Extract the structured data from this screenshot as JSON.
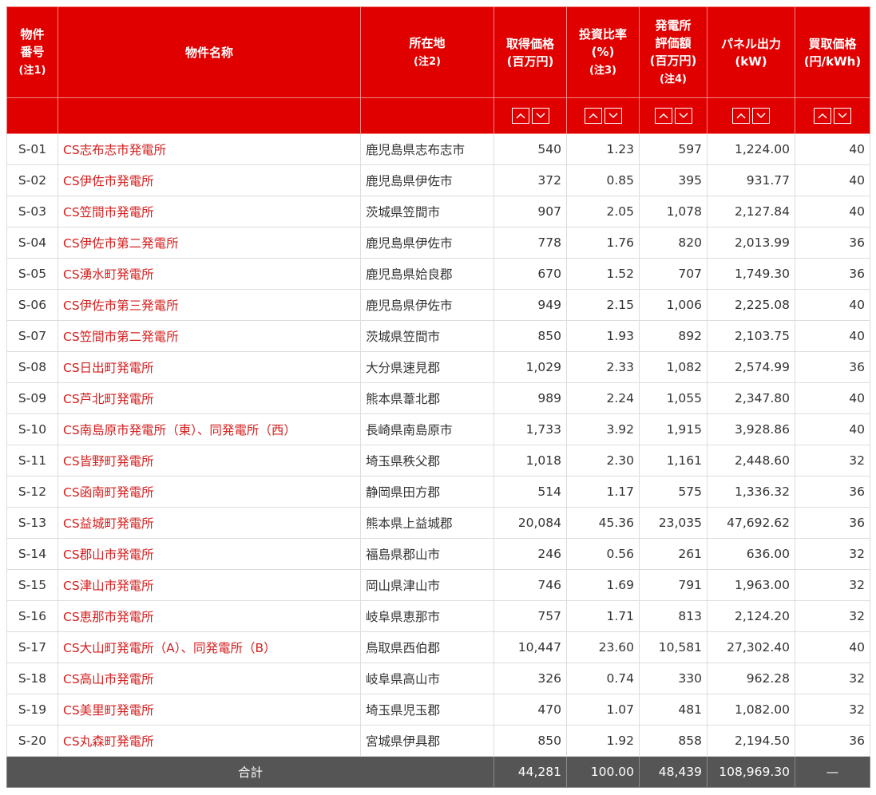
{
  "headers": {
    "id": [
      "物件",
      "番号",
      "(注1)"
    ],
    "name": "物件名称",
    "location": [
      "所在地",
      "(注2)"
    ],
    "price": [
      "取得価格",
      "(百万円)"
    ],
    "ratio": [
      "投資比率",
      "(%)",
      "(注3)"
    ],
    "appraisal": [
      "発電所",
      "評価額",
      "(百万円)",
      "(注4)"
    ],
    "panel": [
      "パネル出力",
      "(kW)"
    ],
    "tariff": [
      "買取価格",
      "(円/kWh)"
    ]
  },
  "rows": [
    {
      "id": "S-01",
      "name": "CS志布志市発電所",
      "location": "鹿児島県志布志市",
      "price": "540",
      "ratio": "1.23",
      "appraisal": "597",
      "panel": "1,224.00",
      "tariff": "40"
    },
    {
      "id": "S-02",
      "name": "CS伊佐市発電所",
      "location": "鹿児島県伊佐市",
      "price": "372",
      "ratio": "0.85",
      "appraisal": "395",
      "panel": "931.77",
      "tariff": "40"
    },
    {
      "id": "S-03",
      "name": "CS笠間市発電所",
      "location": "茨城県笠間市",
      "price": "907",
      "ratio": "2.05",
      "appraisal": "1,078",
      "panel": "2,127.84",
      "tariff": "40"
    },
    {
      "id": "S-04",
      "name": "CS伊佐市第二発電所",
      "location": "鹿児島県伊佐市",
      "price": "778",
      "ratio": "1.76",
      "appraisal": "820",
      "panel": "2,013.99",
      "tariff": "36"
    },
    {
      "id": "S-05",
      "name": "CS湧水町発電所",
      "location": "鹿児島県姶良郡",
      "price": "670",
      "ratio": "1.52",
      "appraisal": "707",
      "panel": "1,749.30",
      "tariff": "36"
    },
    {
      "id": "S-06",
      "name": "CS伊佐市第三発電所",
      "location": "鹿児島県伊佐市",
      "price": "949",
      "ratio": "2.15",
      "appraisal": "1,006",
      "panel": "2,225.08",
      "tariff": "40"
    },
    {
      "id": "S-07",
      "name": "CS笠間市第二発電所",
      "location": "茨城県笠間市",
      "price": "850",
      "ratio": "1.93",
      "appraisal": "892",
      "panel": "2,103.75",
      "tariff": "40"
    },
    {
      "id": "S-08",
      "name": "CS日出町発電所",
      "location": "大分県速見郡",
      "price": "1,029",
      "ratio": "2.33",
      "appraisal": "1,082",
      "panel": "2,574.99",
      "tariff": "36"
    },
    {
      "id": "S-09",
      "name": "CS芦北町発電所",
      "location": "熊本県葦北郡",
      "price": "989",
      "ratio": "2.24",
      "appraisal": "1,055",
      "panel": "2,347.80",
      "tariff": "40"
    },
    {
      "id": "S-10",
      "name": "CS南島原市発電所（東）、同発電所（西）",
      "location": "長崎県南島原市",
      "price": "1,733",
      "ratio": "3.92",
      "appraisal": "1,915",
      "panel": "3,928.86",
      "tariff": "40"
    },
    {
      "id": "S-11",
      "name": "CS皆野町発電所",
      "location": "埼玉県秩父郡",
      "price": "1,018",
      "ratio": "2.30",
      "appraisal": "1,161",
      "panel": "2,448.60",
      "tariff": "32"
    },
    {
      "id": "S-12",
      "name": "CS函南町発電所",
      "location": "静岡県田方郡",
      "price": "514",
      "ratio": "1.17",
      "appraisal": "575",
      "panel": "1,336.32",
      "tariff": "36"
    },
    {
      "id": "S-13",
      "name": "CS益城町発電所",
      "location": "熊本県上益城郡",
      "price": "20,084",
      "ratio": "45.36",
      "appraisal": "23,035",
      "panel": "47,692.62",
      "tariff": "36"
    },
    {
      "id": "S-14",
      "name": "CS郡山市発電所",
      "location": "福島県郡山市",
      "price": "246",
      "ratio": "0.56",
      "appraisal": "261",
      "panel": "636.00",
      "tariff": "32"
    },
    {
      "id": "S-15",
      "name": "CS津山市発電所",
      "location": "岡山県津山市",
      "price": "746",
      "ratio": "1.69",
      "appraisal": "791",
      "panel": "1,963.00",
      "tariff": "32"
    },
    {
      "id": "S-16",
      "name": "CS恵那市発電所",
      "location": "岐阜県恵那市",
      "price": "757",
      "ratio": "1.71",
      "appraisal": "813",
      "panel": "2,124.20",
      "tariff": "32"
    },
    {
      "id": "S-17",
      "name": "CS大山町発電所（A）、同発電所（B）",
      "location": "鳥取県西伯郡",
      "price": "10,447",
      "ratio": "23.60",
      "appraisal": "10,581",
      "panel": "27,302.40",
      "tariff": "40"
    },
    {
      "id": "S-18",
      "name": "CS高山市発電所",
      "location": "岐阜県高山市",
      "price": "326",
      "ratio": "0.74",
      "appraisal": "330",
      "panel": "962.28",
      "tariff": "32"
    },
    {
      "id": "S-19",
      "name": "CS美里町発電所",
      "location": "埼玉県児玉郡",
      "price": "470",
      "ratio": "1.07",
      "appraisal": "481",
      "panel": "1,082.00",
      "tariff": "32"
    },
    {
      "id": "S-20",
      "name": "CS丸森町発電所",
      "location": "宮城県伊具郡",
      "price": "850",
      "ratio": "1.92",
      "appraisal": "858",
      "panel": "2,194.50",
      "tariff": "36"
    }
  ],
  "total": {
    "label": "合計",
    "price": "44,281",
    "ratio": "100.00",
    "appraisal": "48,439",
    "panel": "108,969.30",
    "tariff": "—"
  },
  "sort_icons": [
    "sort-asc-icon",
    "sort-desc-icon"
  ],
  "colors": {
    "header": "#e00000",
    "link": "#d42020",
    "footer": "#555555"
  }
}
